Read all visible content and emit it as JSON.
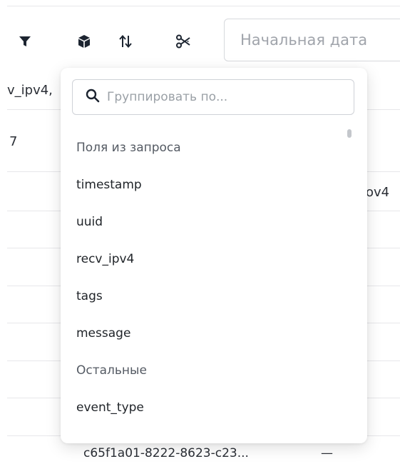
{
  "toolbar": {
    "icons": [
      "filter-icon",
      "cube-icon",
      "sort-icon",
      "scissors-icon"
    ],
    "start_date_placeholder": "Начальная дата"
  },
  "table_background": {
    "header_fragment": "v_ipv4,",
    "count_fragment": "7",
    "column_fragment": "ov4",
    "last_row_id": "c65f1a01-8222-8623-c23...",
    "last_row_dash": "—"
  },
  "group_by_popup": {
    "search_placeholder": "Группировать по...",
    "section_query_fields": "Поля из запроса",
    "query_fields": [
      "timestamp",
      "uuid",
      "recv_ipv4",
      "tags",
      "message"
    ],
    "section_other": "Остальные",
    "other_fields": [
      "event_type"
    ]
  },
  "colors": {
    "icon": "#1c2430",
    "divider": "#e7e7ea",
    "popup_shadow": "rgba(0,0,0,0.13)"
  }
}
